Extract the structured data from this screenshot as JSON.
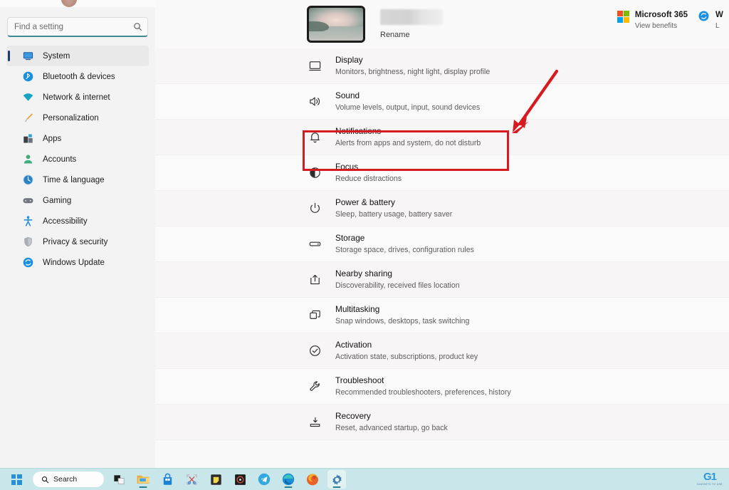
{
  "window": {
    "title": "Settings"
  },
  "sidebar": {
    "search": {
      "placeholder": "Find a setting",
      "value": "",
      "icon": "search-icon"
    },
    "items": [
      {
        "label": "System",
        "icon": "monitor-icon",
        "selected": true
      },
      {
        "label": "Bluetooth & devices",
        "icon": "bluetooth-icon",
        "selected": false
      },
      {
        "label": "Network & internet",
        "icon": "wifi-icon",
        "selected": false
      },
      {
        "label": "Personalization",
        "icon": "paintbrush-icon",
        "selected": false
      },
      {
        "label": "Apps",
        "icon": "apps-grid-icon",
        "selected": false
      },
      {
        "label": "Accounts",
        "icon": "person-icon",
        "selected": false
      },
      {
        "label": "Time & language",
        "icon": "clock-globe-icon",
        "selected": false
      },
      {
        "label": "Gaming",
        "icon": "gamepad-icon",
        "selected": false
      },
      {
        "label": "Accessibility",
        "icon": "accessibility-icon",
        "selected": false
      },
      {
        "label": "Privacy & security",
        "icon": "shield-icon",
        "selected": false
      },
      {
        "label": "Windows Update",
        "icon": "update-sync-icon",
        "selected": false
      }
    ]
  },
  "header": {
    "device_thumbnail": "laptop-wallpaper-thumbnail",
    "device_name": "",
    "device_name_redacted": true,
    "rename_label": "Rename",
    "cards": [
      {
        "icon": "microsoft-logo-icon",
        "title": "Microsoft 365",
        "subtitle": "View benefits"
      },
      {
        "icon": "update-sync-icon",
        "title": "W",
        "subtitle": "L"
      }
    ]
  },
  "main": {
    "settings": [
      {
        "icon": "display-monitor-icon",
        "title": "Display",
        "subtitle": "Monitors, brightness, night light, display profile"
      },
      {
        "icon": "speaker-icon",
        "title": "Sound",
        "subtitle": "Volume levels, output, input, sound devices"
      },
      {
        "icon": "bell-icon",
        "title": "Notifications",
        "subtitle": "Alerts from apps and system, do not disturb",
        "highlighted": true
      },
      {
        "icon": "focus-moon-icon",
        "title": "Focus",
        "subtitle": "Reduce distractions"
      },
      {
        "icon": "power-icon",
        "title": "Power & battery",
        "subtitle": "Sleep, battery usage, battery saver"
      },
      {
        "icon": "storage-drive-icon",
        "title": "Storage",
        "subtitle": "Storage space, drives, configuration rules"
      },
      {
        "icon": "share-icon",
        "title": "Nearby sharing",
        "subtitle": "Discoverability, received files location"
      },
      {
        "icon": "multitask-icon",
        "title": "Multitasking",
        "subtitle": "Snap windows, desktops, task switching"
      },
      {
        "icon": "check-circle-icon",
        "title": "Activation",
        "subtitle": "Activation state, subscriptions, product key"
      },
      {
        "icon": "wrench-icon",
        "title": "Troubleshoot",
        "subtitle": "Recommended troubleshooters, preferences, history"
      },
      {
        "icon": "recovery-icon",
        "title": "Recovery",
        "subtitle": "Reset, advanced startup, go back"
      }
    ]
  },
  "annotations": {
    "highlight_color": "#d71920",
    "highlight_target": "Notifications",
    "arrow_color": "#d71920"
  },
  "taskbar": {
    "start_label": "Start",
    "search_label": "Search",
    "search_icon": "search-icon",
    "items": [
      {
        "name": "task-view",
        "icon": "task-view-icon"
      },
      {
        "name": "file-explorer",
        "icon": "folder-icon"
      },
      {
        "name": "microsoft-store",
        "icon": "store-bag-icon"
      },
      {
        "name": "snipping-tool",
        "icon": "scissors-icon"
      },
      {
        "name": "sticky-notes",
        "icon": "sticky-note-icon"
      },
      {
        "name": "media-app",
        "icon": "dark-disc-icon"
      },
      {
        "name": "telegram",
        "icon": "telegram-icon"
      },
      {
        "name": "microsoft-edge",
        "icon": "edge-icon"
      },
      {
        "name": "firefox",
        "icon": "firefox-icon"
      },
      {
        "name": "settings",
        "icon": "gear-icon"
      }
    ]
  },
  "watermark": {
    "logo": "G1",
    "text": "GADGETS TO USE"
  },
  "colors": {
    "accent": "#3f8a93",
    "annotation_red": "#d71920",
    "desktop": "#e6f6f8",
    "panel": "#faf9f9",
    "sidebar": "#f3f3f3",
    "taskbar": "#c9e7ea"
  }
}
